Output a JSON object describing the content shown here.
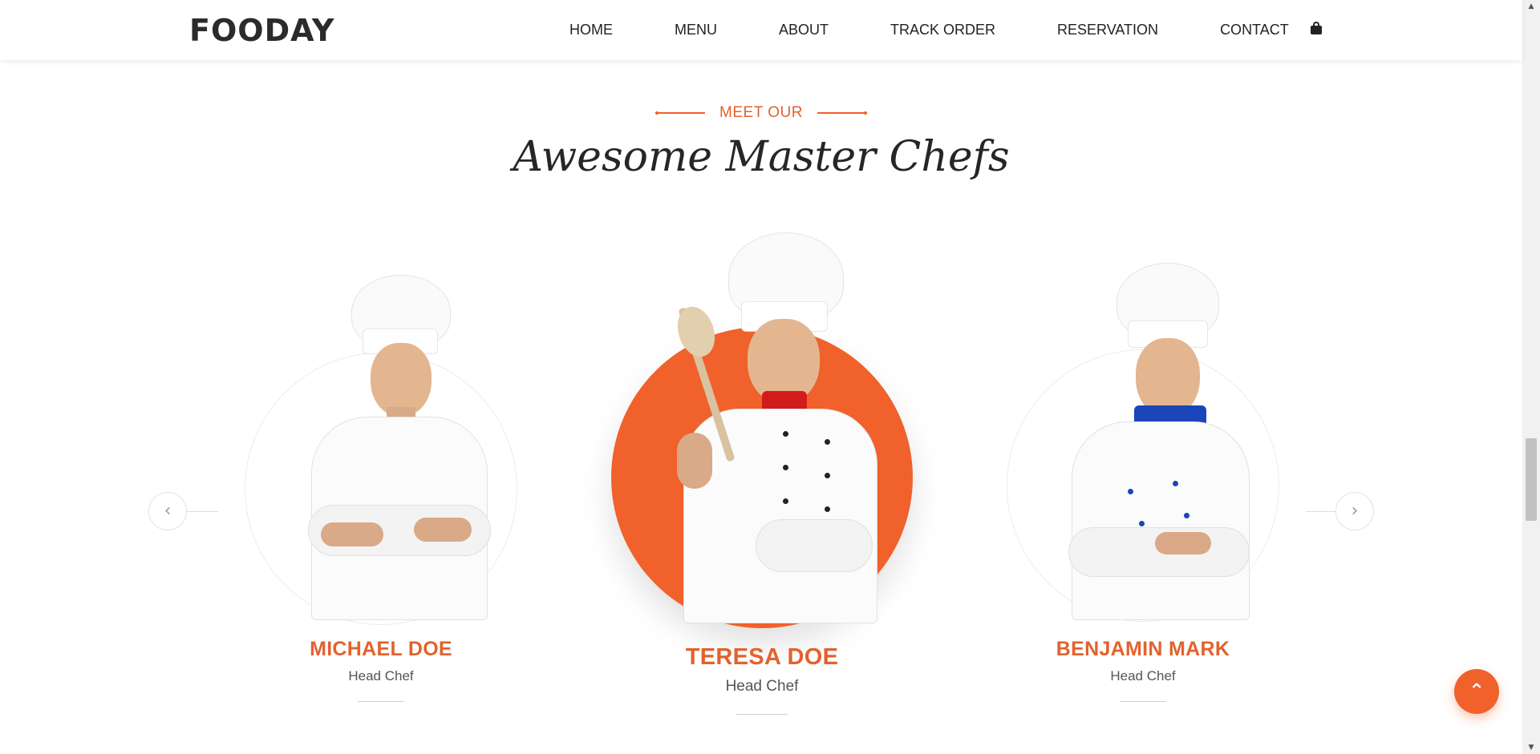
{
  "header": {
    "logo": "FOODAY",
    "nav": [
      "HOME",
      "MENU",
      "ABOUT",
      "TRACK ORDER",
      "RESERVATION",
      "CONTACT"
    ]
  },
  "section": {
    "eyebrow": "MEET OUR",
    "title": "Awesome Master Chefs"
  },
  "chefs": [
    {
      "name": "MICHAEL DOE",
      "role": "Head Chef"
    },
    {
      "name": "TERESA DOE",
      "role": "Head Chef"
    },
    {
      "name": "BENJAMIN MARK",
      "role": "Head Chef"
    }
  ],
  "colors": {
    "accent": "#f0612b",
    "text": "#222222"
  },
  "icons": {
    "cart": "shopping-bag-icon",
    "prev": "chevron-left-icon",
    "next": "chevron-right-icon",
    "to_top": "double-chevron-up-icon"
  }
}
